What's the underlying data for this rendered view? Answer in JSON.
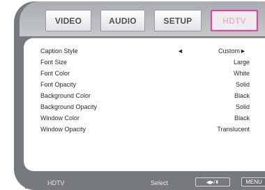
{
  "tabs": [
    {
      "label": "VIDEO",
      "active": false
    },
    {
      "label": "AUDIO",
      "active": false
    },
    {
      "label": "SETUP",
      "active": false
    },
    {
      "label": "HDTV",
      "active": true
    }
  ],
  "settings": [
    {
      "label": "Caption Style",
      "value": "Custom"
    },
    {
      "label": "Font Size",
      "value": "Large"
    },
    {
      "label": "Font Color",
      "value": "White"
    },
    {
      "label": "Font Opacity",
      "value": "Solid"
    },
    {
      "label": "Background Color",
      "value": "Black"
    },
    {
      "label": "Background Opacity",
      "value": "Solid"
    },
    {
      "label": "Window Color",
      "value": "Black"
    },
    {
      "label": "Window Opacity",
      "value": "Translucent"
    }
  ],
  "selector_arrows": {
    "left": "◄",
    "right": "►"
  },
  "footer": {
    "title": "HDTV",
    "select_label": "Select",
    "nav_glyphs": "◀▶/⬍",
    "menu_label": "MENU"
  },
  "colors": {
    "bezel": "#777a7d",
    "active_tab_border": "#d54ba8"
  }
}
